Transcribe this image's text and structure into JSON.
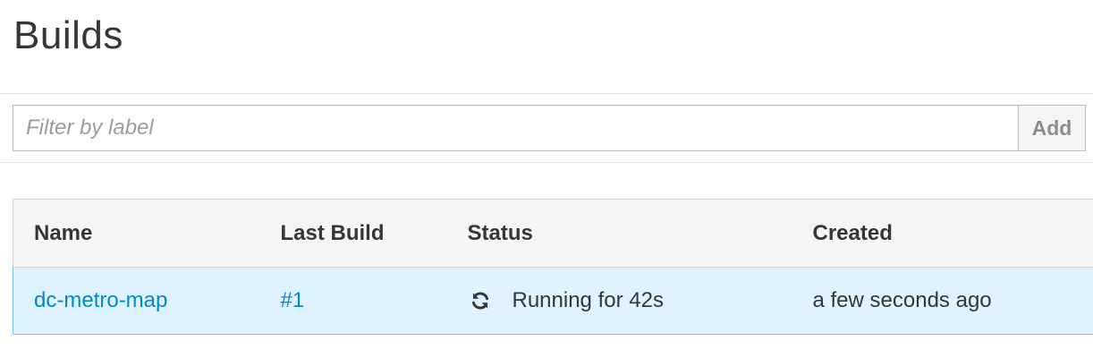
{
  "header": {
    "title": "Builds"
  },
  "filter": {
    "placeholder": "Filter by label",
    "value": "",
    "add_label": "Add"
  },
  "table": {
    "columns": [
      "Name",
      "Last Build",
      "Status",
      "Created"
    ],
    "rows": [
      {
        "name": "dc-metro-map",
        "last_build": "#1",
        "status_icon": "sync-icon",
        "status": "Running for 42s",
        "created": "a few seconds ago"
      }
    ]
  },
  "colors": {
    "link": "#0088ce",
    "selected_row_bg": "#def3ff",
    "selected_row_border": "#7dc3e8",
    "header_bg": "#f5f5f5"
  }
}
